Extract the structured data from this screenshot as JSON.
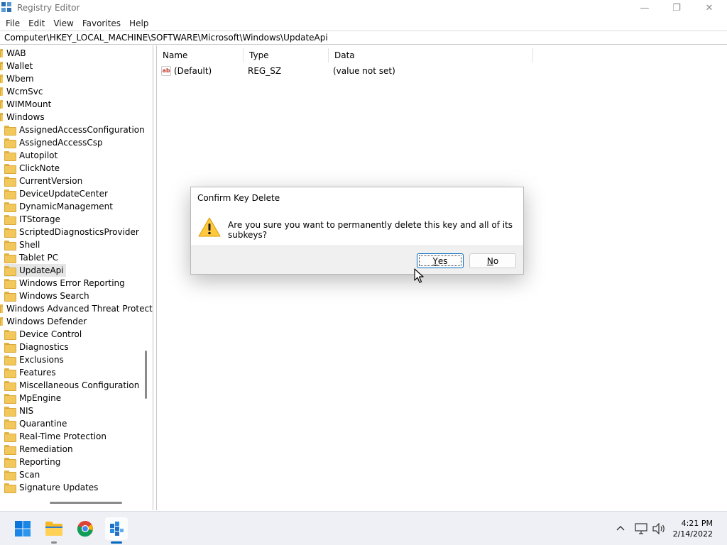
{
  "window": {
    "title": "Registry Editor",
    "controls": {
      "minimize": "—",
      "restore": "❐",
      "close": "✕"
    }
  },
  "menu": [
    "File",
    "Edit",
    "View",
    "Favorites",
    "Help"
  ],
  "address": "Computer\\HKEY_LOCAL_MACHINE\\SOFTWARE\\Microsoft\\Windows\\UpdateApi",
  "tree": {
    "items": [
      {
        "label": "WAB",
        "indent": 0,
        "selected": false
      },
      {
        "label": "Wallet",
        "indent": 0,
        "selected": false
      },
      {
        "label": "Wbem",
        "indent": 0,
        "selected": false
      },
      {
        "label": "WcmSvc",
        "indent": 0,
        "selected": false
      },
      {
        "label": "WIMMount",
        "indent": 0,
        "selected": false
      },
      {
        "label": "Windows",
        "indent": 0,
        "selected": false
      },
      {
        "label": "AssignedAccessConfiguration",
        "indent": 1,
        "selected": false
      },
      {
        "label": "AssignedAccessCsp",
        "indent": 1,
        "selected": false
      },
      {
        "label": "Autopilot",
        "indent": 1,
        "selected": false
      },
      {
        "label": "ClickNote",
        "indent": 1,
        "selected": false
      },
      {
        "label": "CurrentVersion",
        "indent": 1,
        "selected": false
      },
      {
        "label": "DeviceUpdateCenter",
        "indent": 1,
        "selected": false
      },
      {
        "label": "DynamicManagement",
        "indent": 1,
        "selected": false
      },
      {
        "label": "ITStorage",
        "indent": 1,
        "selected": false
      },
      {
        "label": "ScriptedDiagnosticsProvider",
        "indent": 1,
        "selected": false
      },
      {
        "label": "Shell",
        "indent": 1,
        "selected": false
      },
      {
        "label": "Tablet PC",
        "indent": 1,
        "selected": false
      },
      {
        "label": "UpdateApi",
        "indent": 1,
        "selected": true
      },
      {
        "label": "Windows Error Reporting",
        "indent": 1,
        "selected": false
      },
      {
        "label": "Windows Search",
        "indent": 1,
        "selected": false
      },
      {
        "label": "Windows Advanced Threat Protecti",
        "indent": 0,
        "selected": false
      },
      {
        "label": "Windows Defender",
        "indent": 0,
        "selected": false
      },
      {
        "label": "Device Control",
        "indent": 1,
        "selected": false
      },
      {
        "label": "Diagnostics",
        "indent": 1,
        "selected": false
      },
      {
        "label": "Exclusions",
        "indent": 1,
        "selected": false
      },
      {
        "label": "Features",
        "indent": 1,
        "selected": false
      },
      {
        "label": "Miscellaneous Configuration",
        "indent": 1,
        "selected": false
      },
      {
        "label": "MpEngine",
        "indent": 1,
        "selected": false
      },
      {
        "label": "NIS",
        "indent": 1,
        "selected": false
      },
      {
        "label": "Quarantine",
        "indent": 1,
        "selected": false
      },
      {
        "label": "Real-Time Protection",
        "indent": 1,
        "selected": false
      },
      {
        "label": "Remediation",
        "indent": 1,
        "selected": false
      },
      {
        "label": "Reporting",
        "indent": 1,
        "selected": false
      },
      {
        "label": "Scan",
        "indent": 1,
        "selected": false
      },
      {
        "label": "Signature Updates",
        "indent": 1,
        "selected": false
      }
    ]
  },
  "values_table": {
    "headers": {
      "name": "Name",
      "type": "Type",
      "data": "Data"
    },
    "rows": [
      {
        "icon": "string-value-icon",
        "icon_text": "ab",
        "name": "(Default)",
        "type": "REG_SZ",
        "data": "(value not set)"
      }
    ]
  },
  "dialog": {
    "title": "Confirm Key Delete",
    "message": "Are you sure you want to permanently delete this key and all of its subkeys?",
    "icon": "warning-icon",
    "yes_button": {
      "accel": "Y",
      "rest": "es"
    },
    "no_button": {
      "accel": "N",
      "rest": "o"
    }
  },
  "taskbar": {
    "apps": [
      "start-icon",
      "file-explorer-icon",
      "chrome-icon",
      "registry-editor-icon"
    ],
    "tray_icons": [
      "chevron-up-icon",
      "network-icon",
      "volume-icon"
    ],
    "time": "4:21 PM",
    "date": "2/14/2022"
  },
  "colors": {
    "accent": "#0067c0",
    "folder": "#f2c75c",
    "warning": "#ffc83d",
    "selection": "#e5e5e5"
  }
}
